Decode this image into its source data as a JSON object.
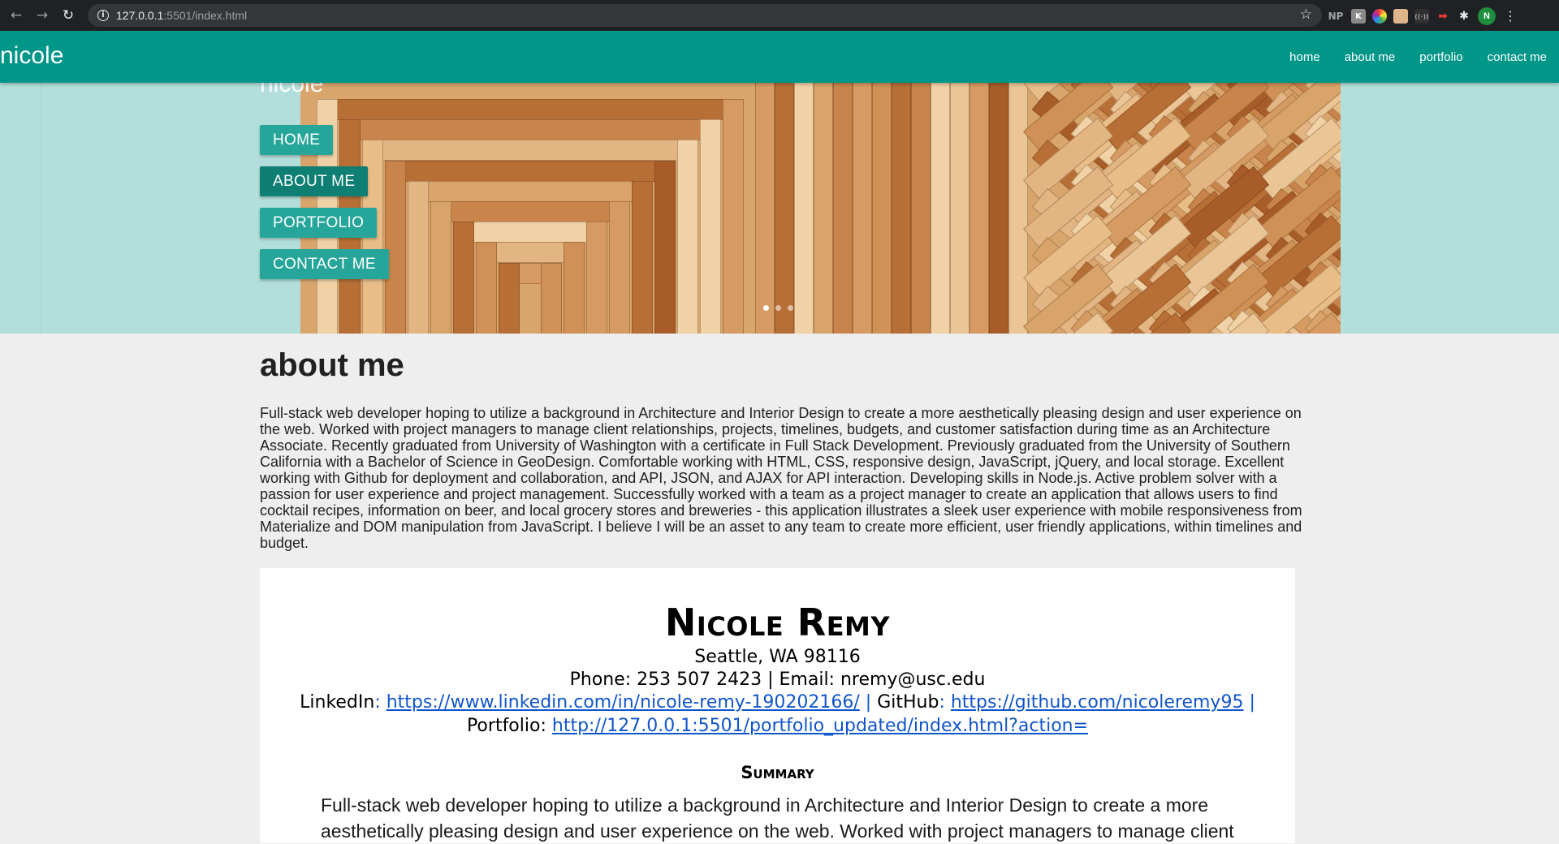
{
  "browser": {
    "url_host": "127.0.0.1",
    "url_rest": ":5501/index.html",
    "extensions": [
      "NP",
      "K",
      "color-picker",
      "face",
      "dark",
      "arrow",
      "puzzle"
    ],
    "profile_initial": "N"
  },
  "navbar": {
    "brand": "nicole",
    "links": [
      "home",
      "about me",
      "portfolio",
      "contact me"
    ]
  },
  "hero": {
    "ghost_brand": "nicole",
    "buttons": [
      "HOME",
      "ABOUT ME",
      "PORTFOLIO",
      "CONTACT ME"
    ],
    "active_button": "ABOUT ME",
    "carousel_dots": 3
  },
  "about": {
    "title": "about me",
    "text": "Full-stack web developer hoping to utilize a background in Architecture and Interior Design to create a more aesthetically pleasing design and user experience on the web. Worked with project managers to manage client relationships, projects, timelines, budgets, and customer satisfaction during time as an Architecture Associate. Recently graduated from University of Washington with a certificate in Full Stack Development. Previously graduated from the University of Southern California with a Bachelor of Science in GeoDesign. Comfortable working with HTML, CSS, responsive design, JavaScript, jQuery, and local storage. Excellent working with Github for deployment and collaboration, and API, JSON, and AJAX for API interaction. Developing skills in Node.js. Active problem solver with a passion for user experience and project management. Successfully worked with a team as a project manager to create an application that allows users to find cocktail recipes, information on beer, and local grocery stores and breweries - this application illustrates a sleek user experience with mobile responsiveness from Materialize and DOM manipulation from JavaScript. I believe I will be an asset to any team to create more efficient, user friendly applications, within timelines and budget."
  },
  "resume": {
    "name": "Nicole Remy",
    "address": "Seattle, WA 98116",
    "phone_email": "Phone: 253 507 2423 | Email: nremy@usc.edu",
    "linkedin_label": "LinkedIn",
    "linkedin_url": "https://www.linkedin.com/in/nicole-remy-190202166/",
    "github_label": "GitHub",
    "github_url": "https://github.com/nicoleremy95",
    "portfolio_label": "Portfolio: ",
    "portfolio_url": "http://127.0.0.1:5501/portfolio_updated/index.html?action=",
    "summary_heading": "Summary",
    "summary_text": "Full-stack web developer hoping to utilize a background in Architecture and Interior Design to create a more aesthetically pleasing design and user experience on the web. Worked with project managers to manage client"
  },
  "colors": {
    "navbar": "#009688",
    "hero_bg": "#b2dfdb",
    "button": "#26a69a",
    "button_active": "#0f7f73",
    "link": "#1155cc"
  }
}
